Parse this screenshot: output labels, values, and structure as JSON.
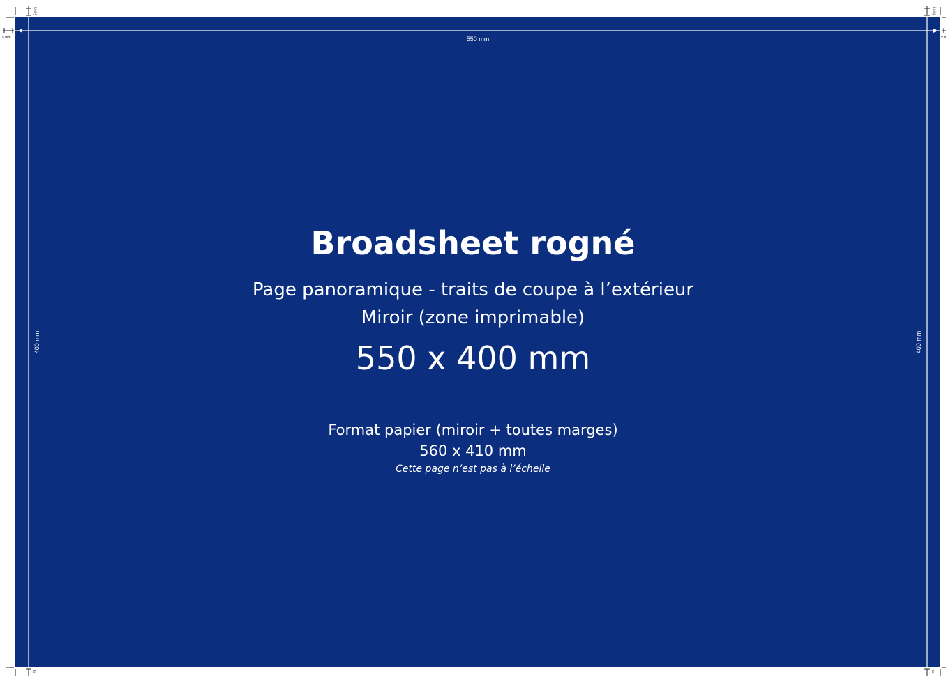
{
  "layout": {
    "title": "Broadsheet rogné",
    "subtitle_line1": "Page panoramique - traits de coupe à l’extérieur",
    "subtitle_line2": "Miroir (zone imprimable)",
    "size": "550 x 400 mm",
    "paper_line1": "Format papier (miroir + toutes marges)",
    "paper_line2": "560 x 410 mm",
    "note": "Cette page n’est pas à l’échelle"
  },
  "dimensions": {
    "width_label": "550 mm",
    "height_label_left": "400 mm",
    "height_label_right": "400 mm",
    "margin_label": "5 mm",
    "margin_label_cut": "5 m",
    "margin_label_short": "m"
  },
  "colors": {
    "background": "#0b2e7e",
    "text": "#ffffff",
    "guide_lines": "#ffffff",
    "crop_marks": "#222222"
  }
}
